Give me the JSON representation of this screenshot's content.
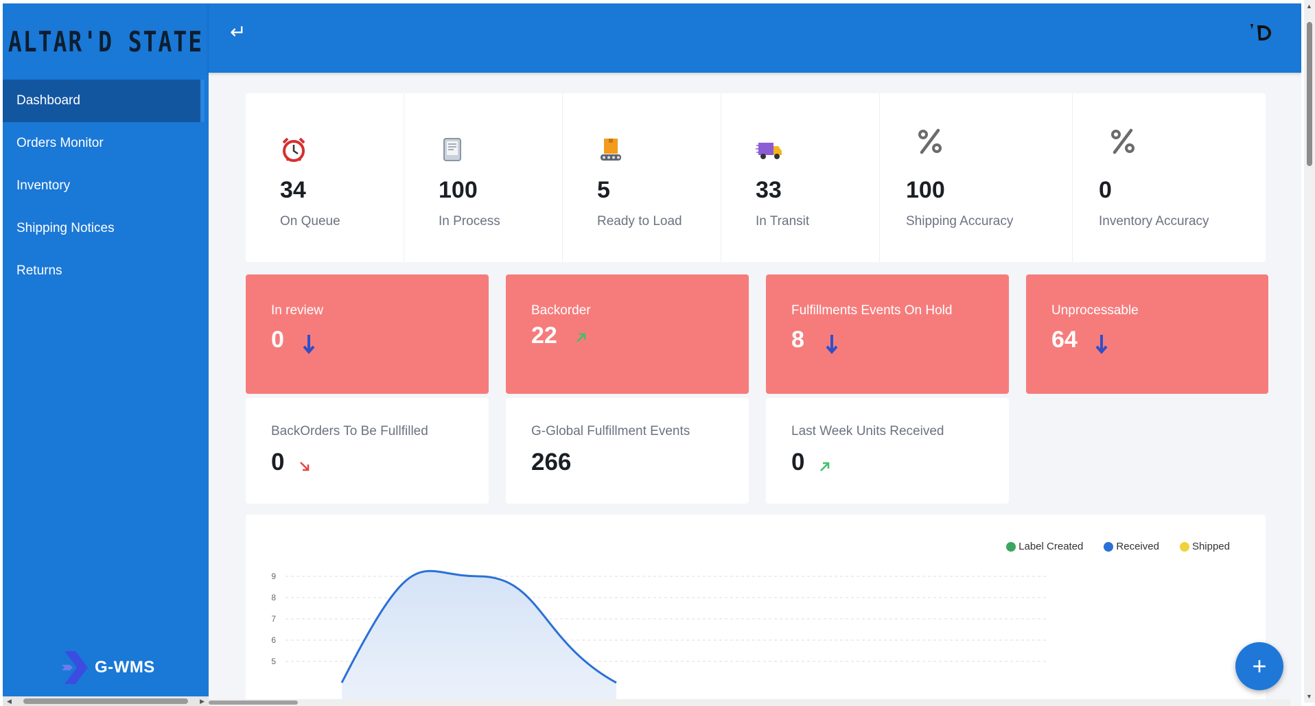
{
  "sidebar": {
    "logo_text": "ALTAR'D STATE",
    "items": [
      {
        "label": "Dashboard",
        "active": true
      },
      {
        "label": "Orders Monitor"
      },
      {
        "label": "Inventory"
      },
      {
        "label": "Shipping Notices"
      },
      {
        "label": "Returns"
      }
    ],
    "footer_brand": "G-WMS"
  },
  "header": {
    "back_icon": "return-arrow-icon",
    "brand_icon": "altar-d-mark-icon"
  },
  "stats": [
    {
      "value": "34",
      "label": "On Queue",
      "icon": "alarm-clock-icon"
    },
    {
      "value": "100",
      "label": "In Process",
      "icon": "document-tablet-icon"
    },
    {
      "value": "5",
      "label": "Ready to Load",
      "icon": "conveyor-box-icon"
    },
    {
      "value": "33",
      "label": "In Transit",
      "icon": "delivery-truck-icon"
    },
    {
      "value": "100",
      "label": "Shipping Accuracy",
      "icon": "percent-icon"
    },
    {
      "value": "0",
      "label": "Inventory Accuracy",
      "icon": "percent-icon"
    }
  ],
  "alert_cards": [
    {
      "title": "In review",
      "value": "0",
      "trend": "down"
    },
    {
      "title": "Backorder",
      "value": "22",
      "trend": "up"
    },
    {
      "title": "Fulfillments Events On Hold",
      "value": "8",
      "trend": "down"
    },
    {
      "title": "Unprocessable",
      "value": "64",
      "trend": "down"
    }
  ],
  "info_cards": [
    {
      "title": "BackOrders To Be Fullfilled",
      "value": "0",
      "trend": "down-right"
    },
    {
      "title": "G-Global Fulfillment Events",
      "value": "266",
      "trend": "none"
    },
    {
      "title": "Last Week Units Received",
      "value": "0",
      "trend": "up-right"
    }
  ],
  "colors": {
    "primary": "#1a78d6",
    "sidebar_active": "#1356a0",
    "alert_card": "#f67c7c",
    "trend_down_blue": "#2f4fc8",
    "trend_up_green": "#3fbf6a",
    "trend_down_red": "#e64545"
  },
  "chart_data": {
    "type": "area",
    "legend": [
      {
        "name": "Label Created",
        "color": "#3aa760"
      },
      {
        "name": "Received",
        "color": "#2b70d6"
      },
      {
        "name": "Shipped",
        "color": "#f2d23c"
      }
    ],
    "y_ticks": [
      "9",
      "8",
      "7",
      "6",
      "5"
    ],
    "ylim": [
      4,
      9
    ],
    "grid": true,
    "series": [
      {
        "name": "Received",
        "values": [
          4,
          9,
          4
        ]
      }
    ]
  },
  "fab_icon": "plus-icon"
}
